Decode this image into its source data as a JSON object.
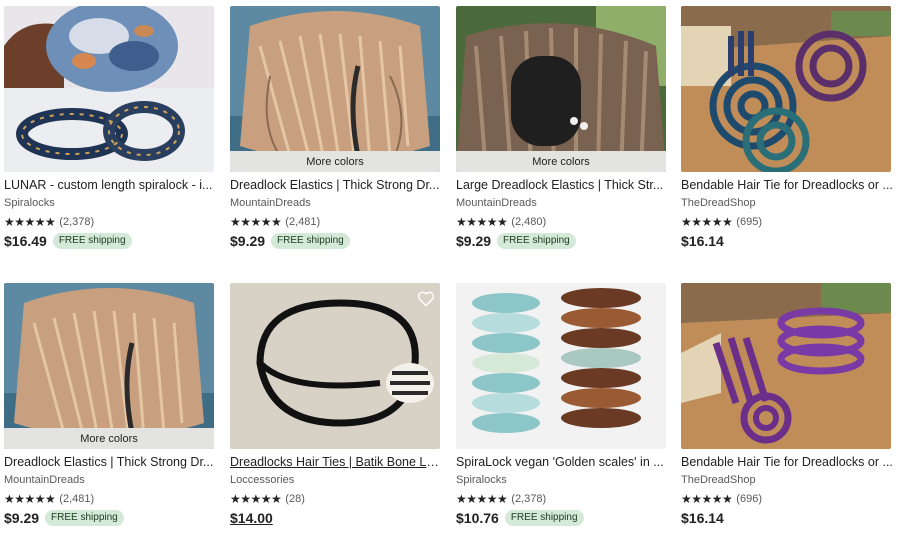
{
  "labels": {
    "more_colors": "More colors",
    "free_shipping": "FREE shipping"
  },
  "listings": [
    {
      "title": "LUNAR - custom length spiralock - i...",
      "shop": "Spiralocks",
      "stars": "★★★★★",
      "reviews": "(2,378)",
      "price": "$16.49",
      "free_shipping": true,
      "more_colors": false,
      "icon": "spiral-hair-tie-image"
    },
    {
      "title": "Dreadlock Elastics | Thick Strong Dr...",
      "shop": "MountainDreads",
      "stars": "★★★★★",
      "reviews": "(2,481)",
      "price": "$9.29",
      "free_shipping": true,
      "more_colors": true,
      "icon": "dreadlock-elastic-image"
    },
    {
      "title": "Large Dreadlock Elastics | Thick Str...",
      "shop": "MountainDreads",
      "stars": "★★★★★",
      "reviews": "(2,480)",
      "price": "$9.29",
      "free_shipping": true,
      "more_colors": true,
      "icon": "large-elastic-image"
    },
    {
      "title": "Bendable Hair Tie for Dreadlocks or ...",
      "shop": "TheDreadShop",
      "stars": "★★★★★",
      "reviews": "(695)",
      "price": "$16.14",
      "free_shipping": false,
      "more_colors": false,
      "icon": "bendable-tie-image"
    },
    {
      "title": "Dreadlock Elastics | Thick Strong Dr...",
      "shop": "MountainDreads",
      "stars": "★★★★★",
      "reviews": "(2,481)",
      "price": "$9.29",
      "free_shipping": true,
      "more_colors": true,
      "icon": "dreadlock-elastic-image"
    },
    {
      "title": "Dreadlocks Hair Ties | Batik Bone Lo...",
      "shop": "Loccessories",
      "stars": "★★★★★",
      "reviews": "(28)",
      "price": "$14.00",
      "free_shipping": false,
      "more_colors": false,
      "icon": "bone-bead-tie-image"
    },
    {
      "title": "SpiraLock vegan 'Golden scales' in ...",
      "shop": "Spiralocks",
      "stars": "★★★★★",
      "reviews": "(2,378)",
      "price": "$10.76",
      "free_shipping": true,
      "more_colors": false,
      "icon": "golden-scales-image"
    },
    {
      "title": "Bendable Hair Tie for Dreadlocks or ...",
      "shop": "TheDreadShop",
      "stars": "★★★★★",
      "reviews": "(696)",
      "price": "$16.14",
      "free_shipping": false,
      "more_colors": false,
      "icon": "purple-bendable-image"
    }
  ],
  "colors": {
    "ship_badge_bg": "#d4e9d7",
    "more_colors_bg": "#e3e3e1"
  }
}
